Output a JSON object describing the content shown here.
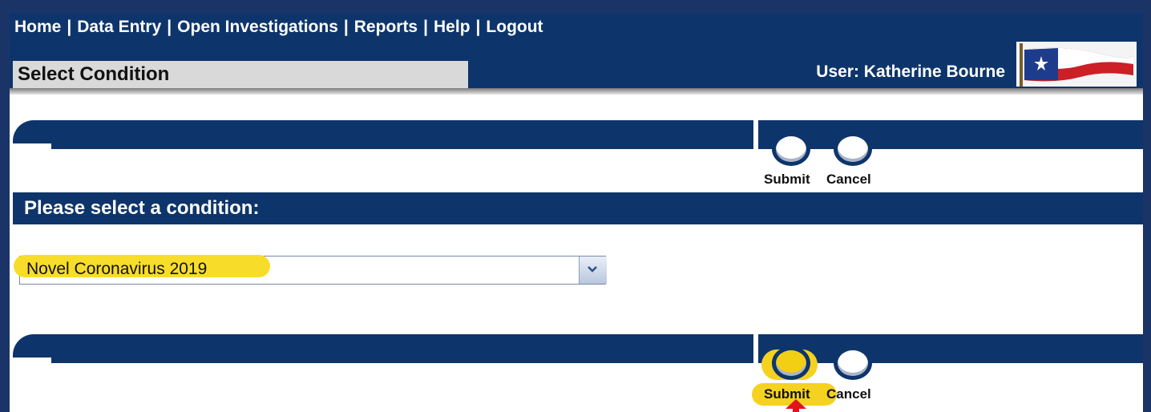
{
  "nav": {
    "links": [
      "Home",
      "Data Entry",
      "Open Investigations",
      "Reports",
      "Help",
      "Logout"
    ],
    "separator": "|"
  },
  "header": {
    "page_title": "Select Condition",
    "user_label": "User: Katherine Bourne"
  },
  "actions_top": {
    "submit_label": "Submit",
    "cancel_label": "Cancel"
  },
  "section": {
    "heading": "Please select a condition:"
  },
  "condition_select": {
    "selected_value": "Novel Coronavirus 2019"
  },
  "actions_bottom": {
    "submit_label": "Submit",
    "cancel_label": "Cancel"
  },
  "colors": {
    "navy": "#0e356b",
    "highlight_yellow": "#f4d21f",
    "annotation_red": "#e0141a"
  },
  "icons": [
    "texas-flag-icon",
    "dropdown-arrow-icon",
    "red-arrow-annotation-icon"
  ]
}
